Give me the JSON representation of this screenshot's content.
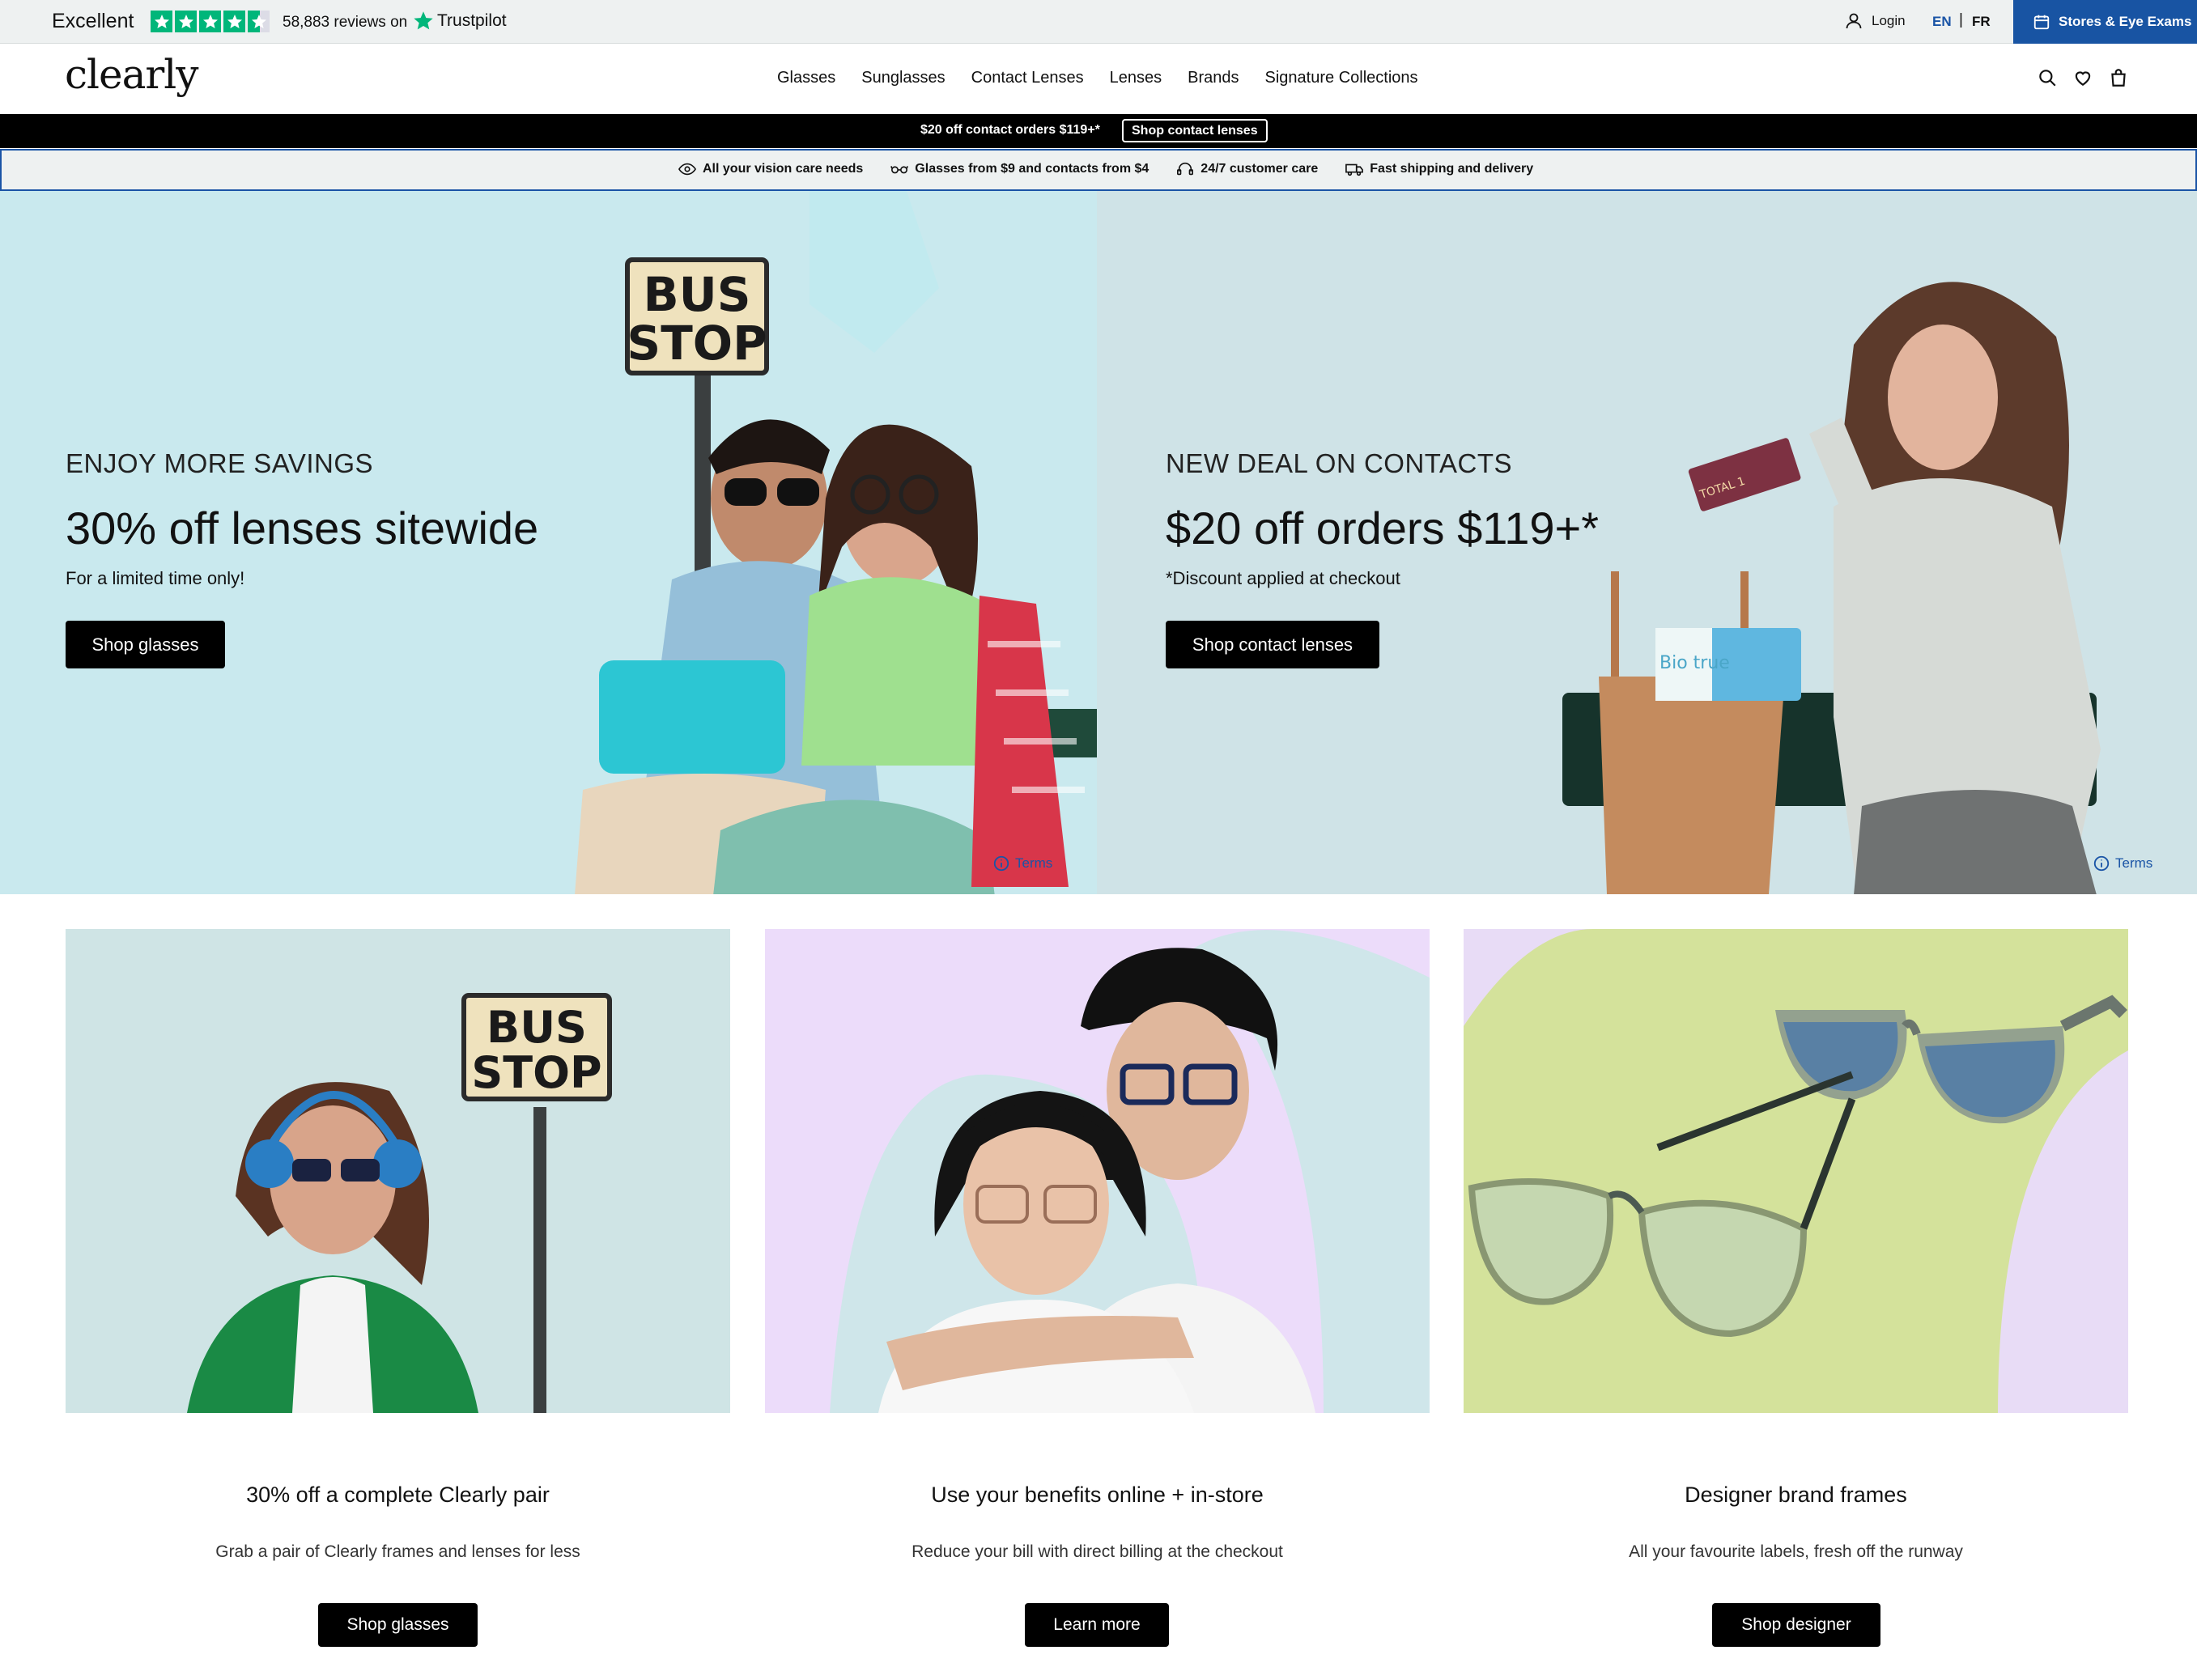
{
  "trustbar": {
    "rating_label": "Excellent",
    "reviews_text": "58,883 reviews on",
    "provider": "Trustpilot",
    "stars": 4.5,
    "login_label": "Login",
    "lang_en": "EN",
    "lang_separator": "|",
    "lang_fr": "FR",
    "stores_label": "Stores & Eye Exams"
  },
  "header": {
    "logo": "clearly",
    "nav": [
      "Glasses",
      "Sunglasses",
      "Contact Lenses",
      "Lenses",
      "Brands",
      "Signature Collections"
    ],
    "icons": [
      "search-icon",
      "heart-icon",
      "bag-icon"
    ]
  },
  "promo": {
    "text": "$20 off contact orders $119+*",
    "button": "Shop contact lenses"
  },
  "value_props": [
    {
      "icon": "eye-icon",
      "label": "All your vision care needs"
    },
    {
      "icon": "glasses-icon",
      "label": "Glasses from $9 and contacts from $4"
    },
    {
      "icon": "headset-icon",
      "label": "24/7 customer care"
    },
    {
      "icon": "truck-icon",
      "label": "Fast shipping and delivery"
    }
  ],
  "hero": {
    "left": {
      "eyebrow": "ENJOY MORE SAVINGS",
      "title": "30% off lenses sitewide",
      "subtitle": "For a limited time only!",
      "button": "Shop glasses",
      "sign_line1": "BUS",
      "sign_line2": "STOP",
      "terms": "Terms"
    },
    "right": {
      "eyebrow": "NEW DEAL ON CONTACTS",
      "title": "$20 off orders $119+*",
      "subtitle": "*Discount applied at checkout",
      "button": "Shop contact lenses",
      "box_label": "TOTAL 1",
      "box2_label": "Bio true",
      "terms": "Terms"
    }
  },
  "cards": [
    {
      "title": "30% off a complete Clearly pair",
      "description": "Grab a pair of Clearly frames and lenses for less",
      "button": "Shop glasses",
      "sign_line1": "BUS",
      "sign_line2": "STOP"
    },
    {
      "title": "Use your benefits online + in-store",
      "description": "Reduce your bill with direct billing at the checkout",
      "button": "Learn more"
    },
    {
      "title": "Designer brand frames",
      "description": "All your favourite labels, fresh off the runway",
      "button": "Shop designer"
    }
  ],
  "colors": {
    "trustpilot_green": "#00b67a",
    "brand_blue": "#1854a3",
    "button_black": "#000000"
  }
}
